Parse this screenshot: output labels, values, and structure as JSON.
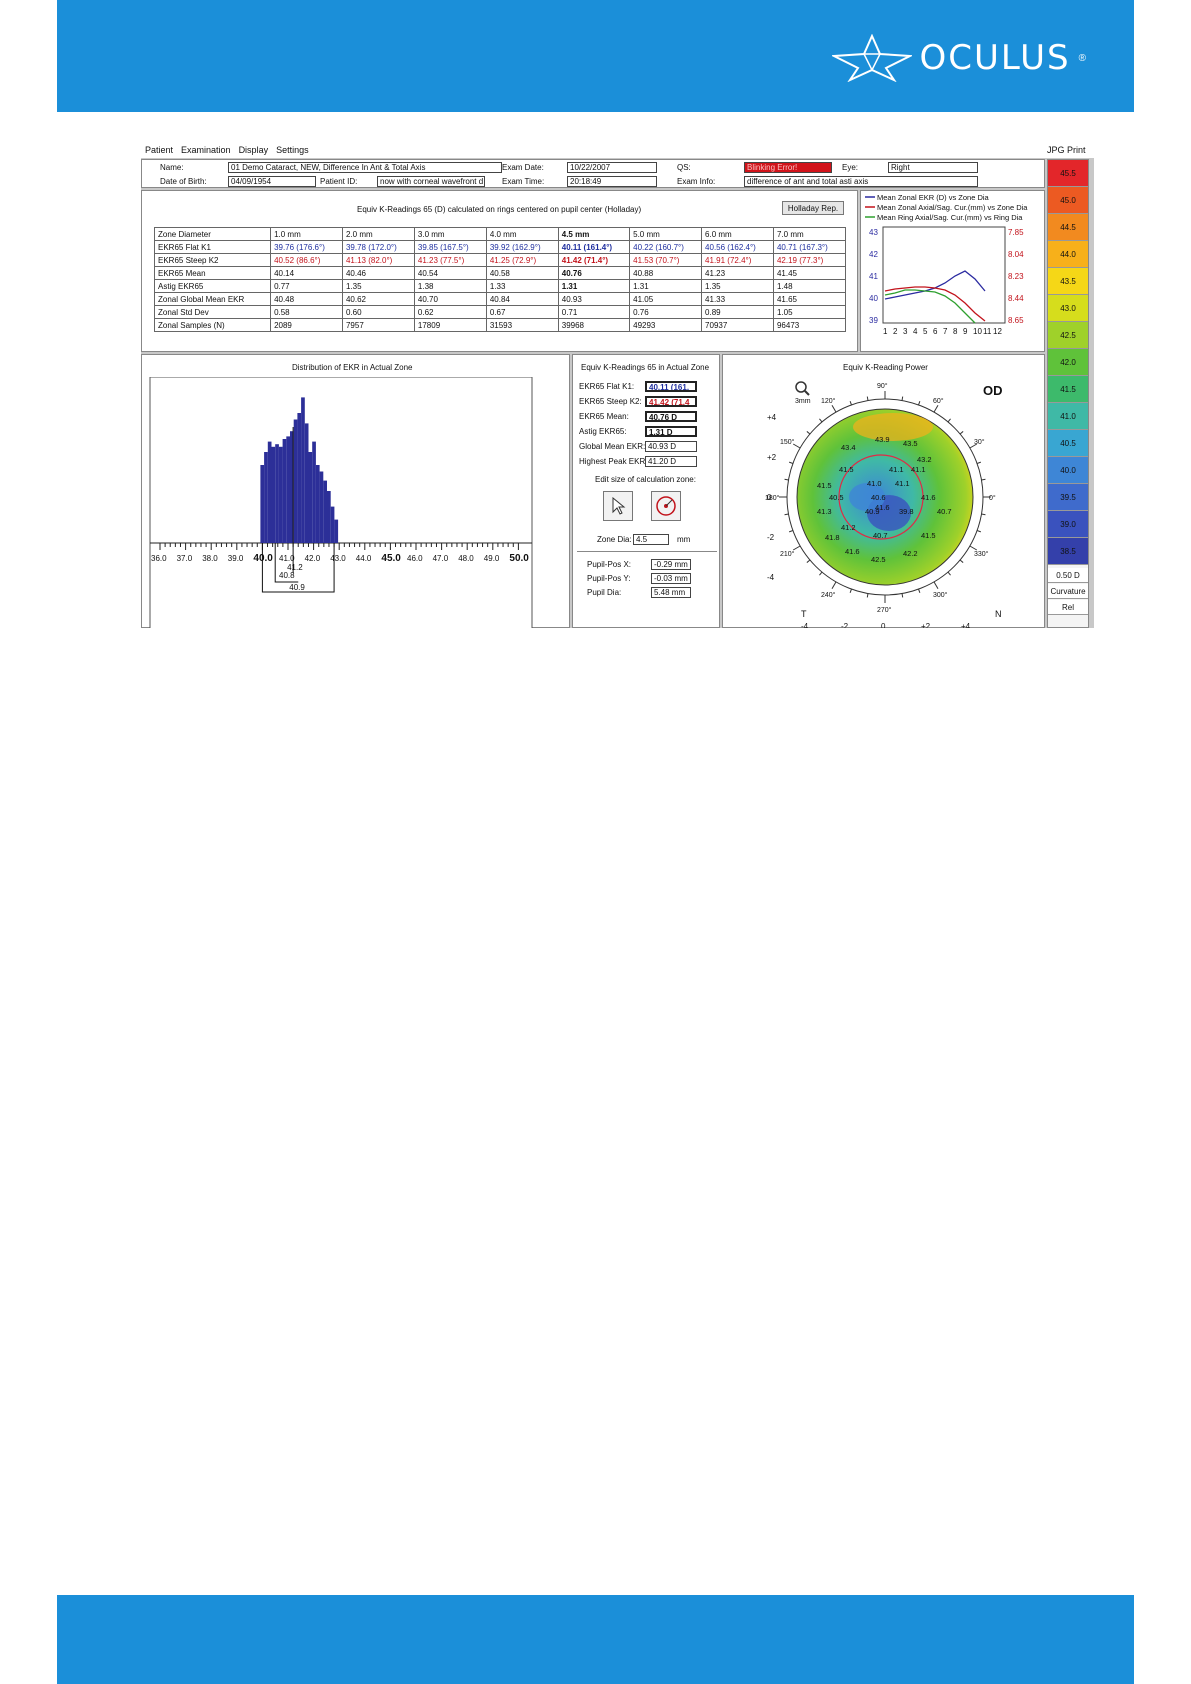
{
  "brand": {
    "name": "OCULUS",
    "reg": "®"
  },
  "menu": {
    "items": [
      "Patient",
      "Examination",
      "Display",
      "Settings"
    ],
    "jpg": "JPG",
    "print": "Print"
  },
  "header": {
    "name_label": "Name:",
    "name_value": "01 Demo Cataract, NEW, Difference In Ant & Total Axis",
    "dob_label": "Date of Birth:",
    "dob_value": "04/09/1954",
    "pid_label": "Patient ID:",
    "pid_value": "now with corneal wavefront d",
    "exam_date_label": "Exam Date:",
    "exam_date_value": "10/22/2007",
    "exam_time_label": "Exam Time:",
    "exam_time_value": "20:18:49",
    "qs_label": "QS:",
    "qs_value": "Blinking Error!",
    "eye_label": "Eye:",
    "eye_value": "Right",
    "exam_info_label": "Exam Info:",
    "exam_info_value": "difference of ant and total asti axis"
  },
  "table_panel": {
    "title": "Equiv K-Readings 65 (D) calculated on rings centered on pupil center (Holladay)",
    "holladay_button": "Holladay Rep."
  },
  "ktable": {
    "header": [
      "Zone Diameter",
      "1.0 mm",
      "2.0 mm",
      "3.0 mm",
      "4.0 mm",
      "4.5 mm",
      "5.0 mm",
      "6.0 mm",
      "7.0 mm"
    ],
    "rows": [
      {
        "label": "EKR65 Flat K1",
        "cells": [
          "39.76 (176.6°)",
          "39.78 (172.0°)",
          "39.85 (167.5°)",
          "39.92 (162.9°)",
          "40.11 (161.4°)",
          "40.22 (160.7°)",
          "40.56 (162.4°)",
          "40.71 (167.3°)"
        ],
        "color": "blue"
      },
      {
        "label": "EKR65 Steep K2",
        "cells": [
          "40.52 (86.6°)",
          "41.13 (82.0°)",
          "41.23 (77.5°)",
          "41.25 (72.9°)",
          "41.42 (71.4°)",
          "41.53 (70.7°)",
          "41.91 (72.4°)",
          "42.19 (77.3°)"
        ],
        "color": "red"
      },
      {
        "label": "EKR65 Mean",
        "cells": [
          "40.14",
          "40.46",
          "40.54",
          "40.58",
          "40.76",
          "40.88",
          "41.23",
          "41.45"
        ],
        "color": ""
      },
      {
        "label": "Astig EKR65",
        "cells": [
          "0.77",
          "1.35",
          "1.38",
          "1.33",
          "1.31",
          "1.31",
          "1.35",
          "1.48"
        ],
        "color": ""
      },
      {
        "label": "Zonal Global Mean EKR",
        "cells": [
          "40.48",
          "40.62",
          "40.70",
          "40.84",
          "40.93",
          "41.05",
          "41.33",
          "41.65"
        ],
        "color": ""
      },
      {
        "label": "Zonal Std Dev",
        "cells": [
          "0.58",
          "0.60",
          "0.62",
          "0.67",
          "0.71",
          "0.76",
          "0.89",
          "1.05"
        ],
        "color": ""
      },
      {
        "label": "Zonal Samples (N)",
        "cells": [
          "2089",
          "7957",
          "17809",
          "31593",
          "39968",
          "49293",
          "70937",
          "96473"
        ],
        "color": ""
      }
    ]
  },
  "line_chart": {
    "legend": [
      "Mean Zonal EKR (D) vs Zone Dia",
      "Mean Zonal Axial/Sag. Cur.(mm) vs Zone Dia",
      "Mean Ring Axial/Sag. Cur.(mm) vs Ring Dia"
    ],
    "colors": [
      "#2a2aa0",
      "#c2131b",
      "#2fa02f"
    ],
    "left_ticks": [
      "43",
      "42",
      "41",
      "40",
      "39"
    ],
    "right_ticks": [
      "7.85",
      "8.04",
      "8.23",
      "8.44",
      "8.65"
    ],
    "x_ticks": [
      "1",
      "2",
      "3",
      "4",
      "5",
      "6",
      "7",
      "8",
      "9",
      "10",
      "11",
      "12"
    ]
  },
  "histogram": {
    "title": "Distribution of EKR in Actual Zone",
    "x_ticks": [
      "36.0",
      "37.0",
      "38.0",
      "39.0",
      "40.0",
      "41.0",
      "42.0",
      "43.0",
      "44.0",
      "45.0",
      "46.0",
      "47.0",
      "48.0",
      "49.0",
      "50.0"
    ],
    "bold_ticks": [
      "40.0",
      "45.0",
      "50.0"
    ],
    "markers": [
      "41.2",
      "40.8",
      "40.9"
    ]
  },
  "actual_zone": {
    "title": "Equiv K-Readings 65 in Actual Zone",
    "rows": [
      {
        "label": "EKR65 Flat K1:",
        "value": "40.11 (161.",
        "color": "blue"
      },
      {
        "label": "EKR65 Steep K2:",
        "value": "41.42 (71.4",
        "color": "red"
      },
      {
        "label": "EKR65 Mean:",
        "value": "40.76 D",
        "color": "bold"
      },
      {
        "label": "Astig EKR65:",
        "value": "1.31 D",
        "color": "bold"
      },
      {
        "label": "Global Mean EKR:",
        "value": "40.93 D",
        "color": ""
      },
      {
        "label": "Highest Peak EKR:",
        "value": "41.20 D",
        "color": ""
      }
    ],
    "edit_label": "Edit size of calculation zone:",
    "zone_dia_label": "Zone Dia:",
    "zone_dia_value": "4.5",
    "zone_dia_unit": "mm",
    "pupil": [
      {
        "label": "Pupil-Pos X:",
        "value": "-0.29 mm"
      },
      {
        "label": "Pupil-Pos Y:",
        "value": "-0.03 mm"
      },
      {
        "label": "Pupil Dia:",
        "value": "5.48 mm"
      }
    ]
  },
  "map": {
    "title": "Equiv K-Reading Power",
    "eye": "OD",
    "zoom": "3mm",
    "axis_left": [
      "+4",
      "+2",
      "0",
      "-2",
      "-4"
    ],
    "axis_bottom": [
      "-4",
      "-2",
      "0",
      "+2",
      "+4"
    ],
    "angles": [
      "30°",
      "60°",
      "90°",
      "120°",
      "150°",
      "180°",
      "210°",
      "240°",
      "270°",
      "300°",
      "330°",
      "0°"
    ],
    "corner_t": "T",
    "corner_n": "N",
    "values": [
      "43.9",
      "43.5",
      "43.4",
      "43.2",
      "41.5",
      "41.0",
      "41.1",
      "41.1",
      "41.5",
      "40.5",
      "40.6",
      "41.6",
      "40.7",
      "41.6",
      "41.2",
      "40.9",
      "41.3",
      "41.8",
      "40.7",
      "41.5",
      "41.6",
      "42.5",
      "42.2",
      "39.8",
      "41.1"
    ]
  },
  "color_scale": {
    "values": [
      "45.5",
      "45.0",
      "44.5",
      "44.0",
      "43.5",
      "43.0",
      "42.5",
      "42.0",
      "41.5",
      "41.0",
      "40.5",
      "40.0",
      "39.5",
      "39.0",
      "38.5"
    ],
    "colors": [
      "#e3262a",
      "#ec5a22",
      "#f28a1f",
      "#f7b01a",
      "#f5d717",
      "#d6dd1c",
      "#9fd12a",
      "#5fc23a",
      "#3dba6b",
      "#3fb9a6",
      "#39a6d2",
      "#3e86d6",
      "#3f6bcc",
      "#3a52be",
      "#3440aa"
    ],
    "step": "0.50 D",
    "type": "Curvature",
    "mode": "Rel"
  }
}
